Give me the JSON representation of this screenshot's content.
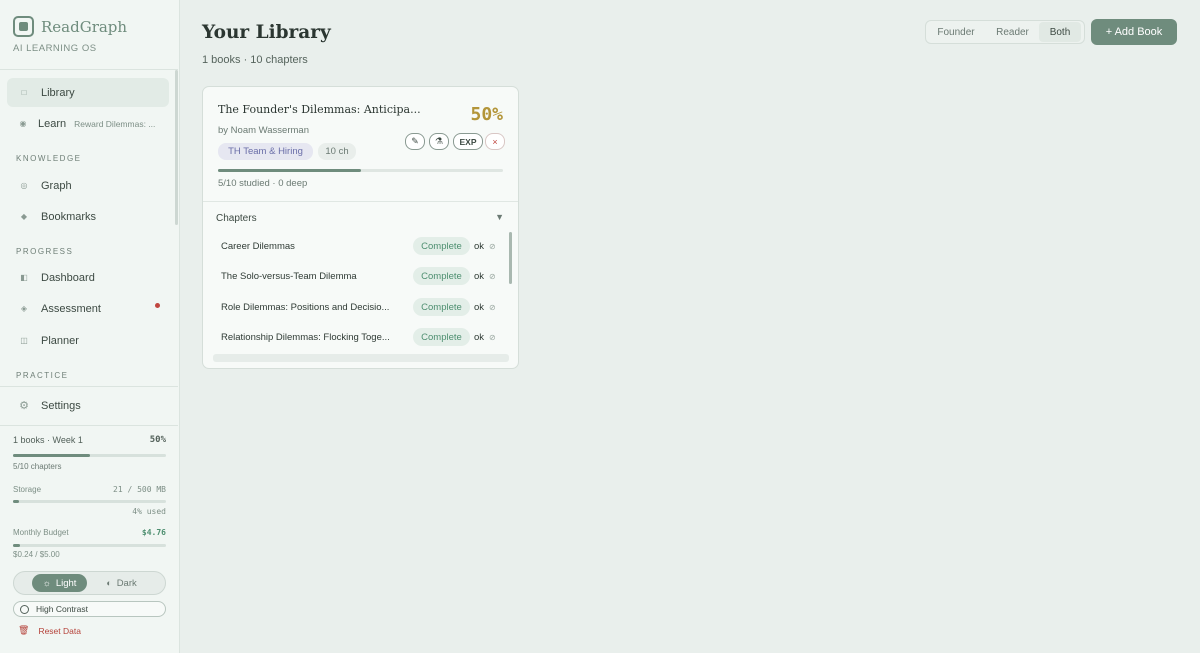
{
  "app": {
    "name": "ReadGraph",
    "tagline": "AI LEARNING OS"
  },
  "sidebar": {
    "nav": [
      {
        "label": "Library",
        "icon": "square-icon",
        "active": true
      },
      {
        "label": "Learn",
        "icon": "circle-dot-icon",
        "sub": "Reward Dilemmas: ..."
      }
    ],
    "knowledge_heading": "KNOWLEDGE",
    "knowledge": [
      {
        "label": "Graph",
        "icon": "graph-icon"
      },
      {
        "label": "Bookmarks",
        "icon": "diamond-icon"
      }
    ],
    "progress_heading": "PROGRESS",
    "progress": [
      {
        "label": "Dashboard",
        "icon": "dashboard-icon"
      },
      {
        "label": "Assessment",
        "icon": "diamond-icon",
        "badge": true
      },
      {
        "label": "Planner",
        "icon": "planner-icon"
      }
    ],
    "practice_heading": "PRACTICE",
    "settings_label": "Settings",
    "stats": {
      "summary": "1 books · Week 1",
      "summary_pct": "50%",
      "summary_progress": 0.5,
      "chapters": "5/10 chapters",
      "storage_label": "Storage",
      "storage_value": "21 / 500 MB",
      "storage_pct_text": "4% used",
      "storage_progress": 0.04,
      "budget_label": "Monthly Budget",
      "budget_value": "$4.76",
      "budget_spent": "$0.24 / $5.00",
      "budget_progress": 0.048
    },
    "theme": {
      "light": "Light",
      "dark": "Dark",
      "selected": "Light"
    },
    "high_contrast_label": "High Contrast",
    "reset_label": "Reset Data"
  },
  "main": {
    "title": "Your Library",
    "subtitle": "1 books · 10 chapters",
    "filter": {
      "options": [
        "Founder",
        "Reader",
        "Both"
      ],
      "selected": "Both"
    },
    "add_button": "+ Add Book",
    "book": {
      "title": "The Founder's Dilemmas: Anticipa...",
      "percent": "50%",
      "author": "by Noam Wasserman",
      "topic_chip": "TH Team & Hiring",
      "chapter_chip": "10 ch",
      "actions": {
        "exp_label": "EXP",
        "delete_label": "×"
      },
      "progress": 0.5,
      "meta": "5/10 studied · 0 deep",
      "chapters_heading": "Chapters",
      "chapters_toggle": "▼",
      "chapters": [
        {
          "name": "Career Dilemmas",
          "status": "Complete",
          "ok": "ok"
        },
        {
          "name": "The Solo-versus-Team Dilemma",
          "status": "Complete",
          "ok": "ok"
        },
        {
          "name": "Role Dilemmas: Positions and Decisio...",
          "status": "Complete",
          "ok": "ok"
        },
        {
          "name": "Relationship Dilemmas: Flocking Toge...",
          "status": "Complete",
          "ok": "ok"
        }
      ]
    }
  },
  "colors": {
    "accent": "#6f8c7d",
    "percent_gold": "#b39539",
    "status_green": "#4e8f70",
    "danger": "#c0463f",
    "topic_purple": "#6a6ea8"
  }
}
